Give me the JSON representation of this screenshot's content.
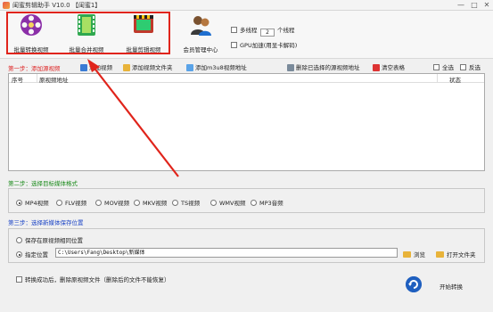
{
  "window": {
    "title": "闺蜜剪辑助手 V10.0  【闺蜜1】",
    "minimize": "—",
    "maximize": "□",
    "close": "✕"
  },
  "toolbar": {
    "tools": [
      {
        "label": "批量转换视频",
        "icon": "film-reel-icon"
      },
      {
        "label": "批量合并视频",
        "icon": "film-strip-icon"
      },
      {
        "label": "批量剪辑视频",
        "icon": "clapperboard-icon"
      },
      {
        "label": "会员管理中心",
        "icon": "users-icon"
      }
    ],
    "multithread_label": "多线程",
    "thread_count": "2",
    "thread_unit": "个线程",
    "gpu_label": "GPU加速(用显卡解码)"
  },
  "step1": {
    "title": "第一步：添加源视频",
    "add_video": "添加视频",
    "add_folder": "添加视频文件夹",
    "add_m3u8": "添加m3u8视频地址",
    "delete_selected": "删除已选择的源视频地址",
    "clear_table": "清空表格",
    "select_all": "全选",
    "invert": "反选"
  },
  "table": {
    "columns": [
      "序号",
      "原视频地址",
      "状态"
    ]
  },
  "step2": {
    "title": "第二步：选择目标媒体格式",
    "formats": [
      "MP4视频",
      "FLV视频",
      "MOV视频",
      "MKV视频",
      "TS视频",
      "WMV视频",
      "MP3音频"
    ],
    "selected": "MP4视频"
  },
  "step3": {
    "title": "第三步：选择新媒体保存位置",
    "same_location": "保存在原视频相同位置",
    "custom_location": "指定位置",
    "path": "C:\\Users\\Fang\\Desktop\\新媒体",
    "browse": "浏览",
    "open_folder": "打开文件夹"
  },
  "footer": {
    "delete_after": "转换成功后，删除原视频文件（删除后的文件不能恢复）",
    "start": "开始转换"
  },
  "colors": {
    "annotation": "#e0241b",
    "step1": "#d22222",
    "step2": "#1a8a1a",
    "step3": "#1a43c6"
  }
}
